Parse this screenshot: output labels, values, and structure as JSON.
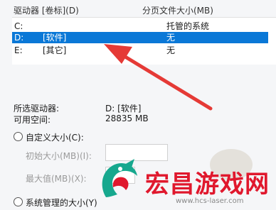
{
  "drive_list": {
    "column_drive": "驱动器 [卷标](D)",
    "column_paging_size": "分页文件大小(MB)",
    "rows": [
      {
        "drive": "C:",
        "label": "",
        "size": "托管的系统"
      },
      {
        "drive": "D:",
        "label": "[软件]",
        "size": "无"
      },
      {
        "drive": "E:",
        "label": "[其它]",
        "size": "无"
      }
    ],
    "selected_color": "#0a78d7"
  },
  "details": {
    "selected_drive_label": "所选驱动器:",
    "selected_drive_value": "D:  [软件]",
    "free_space_label": "可用空间:",
    "free_space_value": "28835 MB"
  },
  "options": {
    "custom_size": "自定义大小(C):",
    "initial_size": "初始大小(MB)(I):",
    "max_size": "最大值(MB)(X):",
    "system_managed": "系统管理的大小(Y)"
  },
  "watermark": {
    "brand": "宏昌游戏网",
    "url": "www.hcs-laser.com",
    "brand_color": "#e0182d"
  },
  "arrow_color": "#e53a36"
}
